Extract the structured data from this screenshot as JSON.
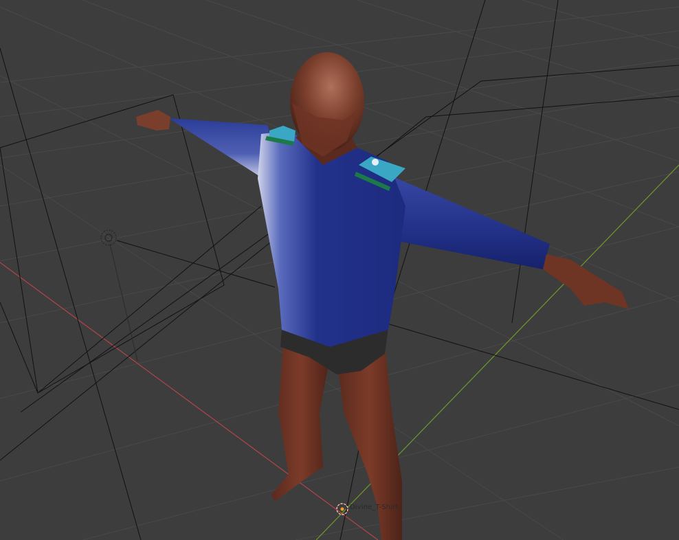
{
  "viewport": {
    "background": "#3d3d3d",
    "grid_color": "#494949",
    "x_axis_color": "#b3454b",
    "y_axis_color": "#6d9a2a",
    "wire_color": "#111111"
  },
  "selected_object": {
    "name": "Divine_T-Shirt"
  },
  "character": {
    "skin_color": "#6e3424",
    "shirt_color": "#1f2f86",
    "shorts_color": "#2c2c2c",
    "patch_color": "#3aa7c4",
    "stripe_color": "#1c7a49"
  },
  "icons": {
    "light": "light-icon",
    "origin": "origin-icon"
  }
}
